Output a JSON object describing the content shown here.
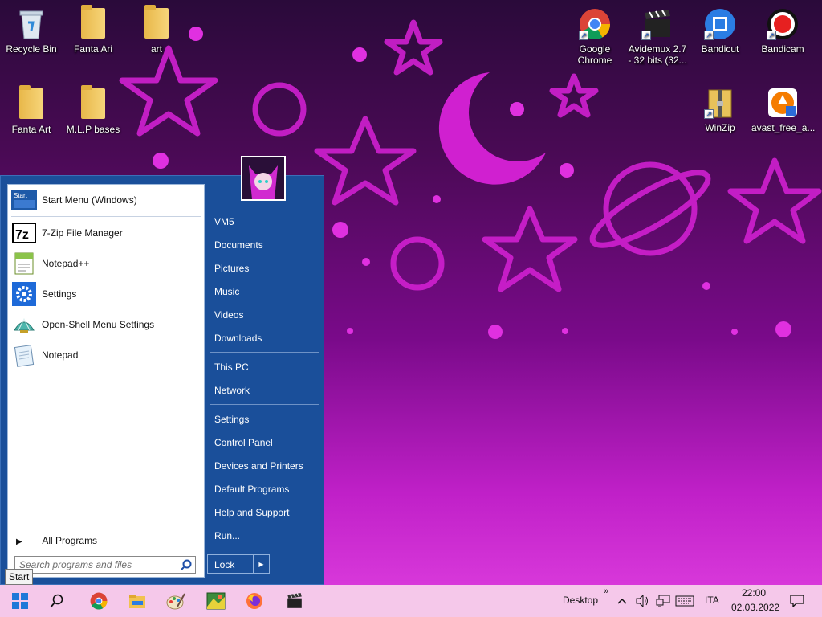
{
  "desktop": {
    "icons": [
      {
        "label": "Recycle Bin",
        "icon": "recycle-bin-icon"
      },
      {
        "label": "Fanta Ari",
        "icon": "folder-icon"
      },
      {
        "label": "art",
        "icon": "folder-icon"
      },
      {
        "label": "Fanta Art",
        "icon": "folder-icon"
      },
      {
        "label": "M.L.P bases",
        "icon": "folder-icon"
      },
      {
        "label": "Google Chrome",
        "icon": "chrome-icon"
      },
      {
        "label": "Avidemux 2.7 - 32 bits (32...",
        "icon": "avidemux-icon"
      },
      {
        "label": "Bandicut",
        "icon": "bandicut-icon"
      },
      {
        "label": "Bandicam",
        "icon": "bandicam-icon"
      },
      {
        "label": "WinZip",
        "icon": "winzip-icon"
      },
      {
        "label": "avast_free_a...",
        "icon": "avast-icon"
      }
    ]
  },
  "start_menu": {
    "pinned": [
      {
        "label": "Start Menu (Windows)",
        "icon": "start-menu-icon"
      },
      {
        "label": "7-Zip File Manager",
        "icon": "7zip-icon"
      },
      {
        "label": "Notepad++",
        "icon": "notepad-plus-icon"
      },
      {
        "label": "Settings",
        "icon": "gear-icon"
      },
      {
        "label": "Open-Shell Menu Settings",
        "icon": "shell-icon"
      },
      {
        "label": "Notepad",
        "icon": "notepad-icon"
      }
    ],
    "start_icon_text": "Start",
    "all_programs": "All Programs",
    "search_placeholder": "Search programs and files",
    "right_items": {
      "group1": [
        "VM5",
        "Documents",
        "Pictures",
        "Music",
        "Videos",
        "Downloads"
      ],
      "group2": [
        "This PC",
        "Network"
      ],
      "group3": [
        "Settings",
        "Control Panel",
        "Devices and Printers",
        "Default Programs",
        "Help and Support",
        "Run..."
      ]
    },
    "lock_label": "Lock",
    "tooltip": "Start"
  },
  "taskbar": {
    "pinned_icons": [
      "start-button",
      "search-icon",
      "chrome-icon",
      "file-explorer-icon",
      "paint-icon",
      "image-viewer-icon",
      "firefox-icon",
      "avidemux-icon"
    ],
    "desktop_label": "Desktop",
    "overflow": "»",
    "language": "ITA",
    "time": "22:00",
    "date": "02.03.2022"
  }
}
